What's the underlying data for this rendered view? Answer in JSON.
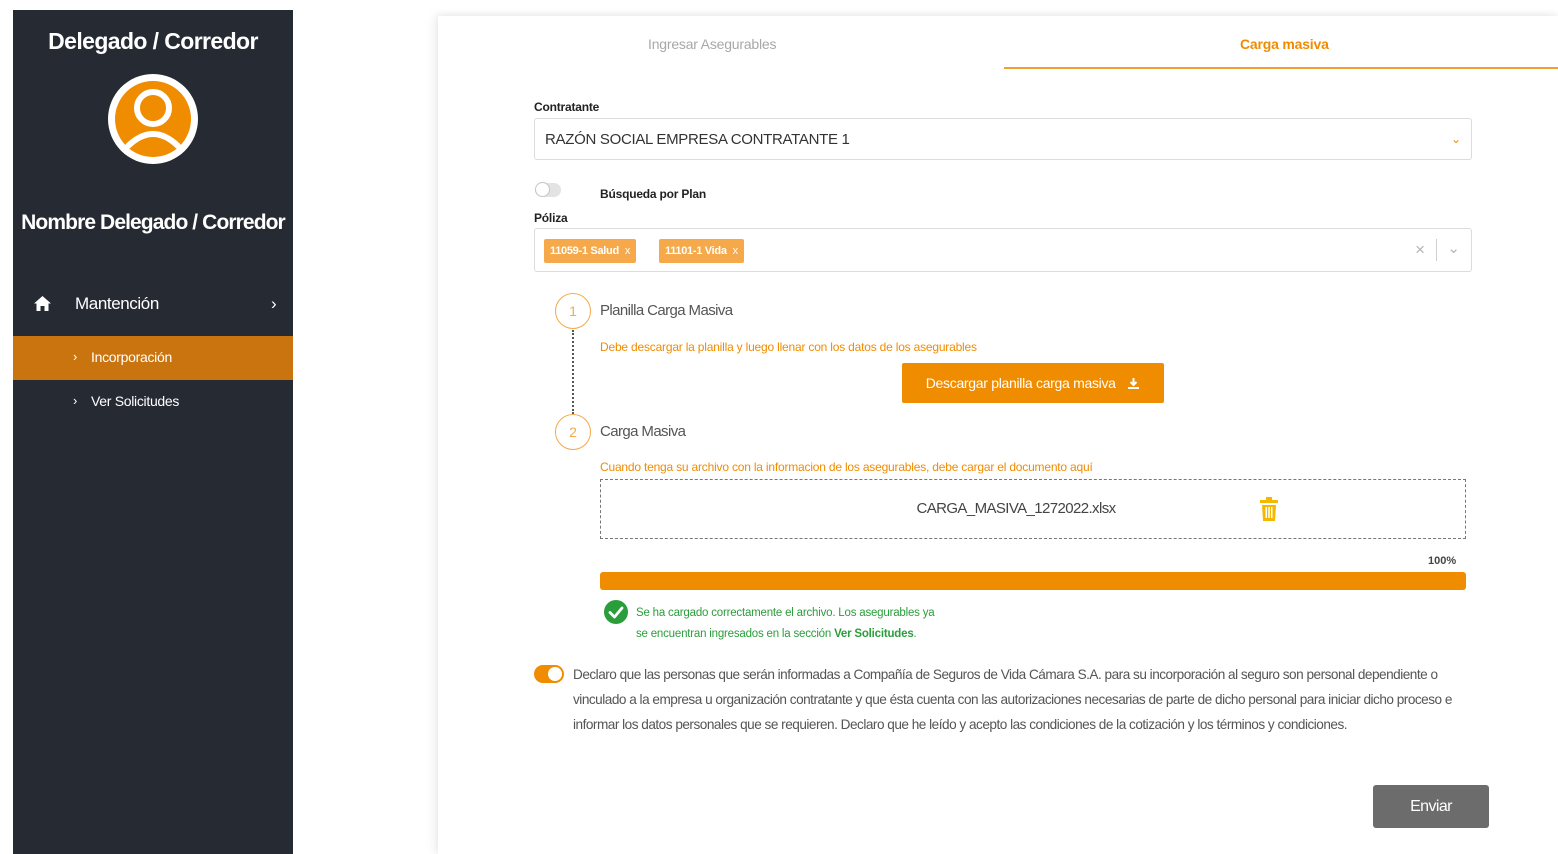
{
  "sidebar": {
    "role_title": "Delegado / Corredor",
    "user_name": "Nombre Delegado / Corredor",
    "menu": {
      "label": "Mantención",
      "icon": "home-icon",
      "chevron": "›",
      "items": [
        {
          "label": "Incorporación",
          "active": true
        },
        {
          "label": "Ver Solicitudes",
          "active": false
        }
      ]
    },
    "bullet": "›"
  },
  "tabs": [
    {
      "label": "Ingresar Asegurables",
      "active": false
    },
    {
      "label": "Carga masiva",
      "active": true
    }
  ],
  "form": {
    "contratante_label": "Contratante",
    "contratante_value": "RAZÓN SOCIAL EMPRESA CONTRATANTE 1",
    "busqueda_plan_label": "Búsqueda por Plan",
    "busqueda_plan_on": false,
    "poliza_label": "Póliza",
    "poliza_chips": [
      "11059-1 Salud",
      "11101-1 Vida"
    ],
    "chip_remove": "x",
    "clear_symbol": "×",
    "dropdown_symbol": "⌄"
  },
  "steps": [
    {
      "number": "1",
      "title": "Planilla Carga Masiva",
      "hint": "Debe descargar la planilla y luego llenar con los datos de los asegurables",
      "button_label": "Descargar planilla carga masiva"
    },
    {
      "number": "2",
      "title": "Carga Masiva",
      "hint": "Cuando tenga su archivo con la informacion de los asegurables, debe cargar el documento aquí"
    }
  ],
  "upload": {
    "file_name": "CARGA_MASIVA_1272022.xlsx",
    "progress_percent": 100,
    "progress_text": "100%",
    "success_line1": "Se ha cargado correctamente el archivo. Los asegurables ya",
    "success_line2_prefix": "se encuentran ingresados en la sección ",
    "success_line2_link": "Ver Solicitudes",
    "success_line2_suffix": "."
  },
  "declaration": {
    "accepted": true,
    "text": "Declaro que las personas que serán informadas a Compañía de Seguros de Vida Cámara S.A. para su incorporación al seguro son personal dependiente o vinculado a la empresa u organización contratante y que ésta cuenta con las autorizaciones necesarias de parte de dicho personal para iniciar dicho proceso e informar los datos personales que se requieren. Declaro que he leído y acepto las condiciones de la cotización y los términos y condiciones."
  },
  "send_button": "Enviar",
  "colors": {
    "accent": "#f08c00",
    "sidebar_bg": "#262b33",
    "active_item_bg": "#c9740f",
    "chip_bg": "#f5a94a",
    "success": "#2a9e3a",
    "send_bg": "#6c6c6c"
  }
}
